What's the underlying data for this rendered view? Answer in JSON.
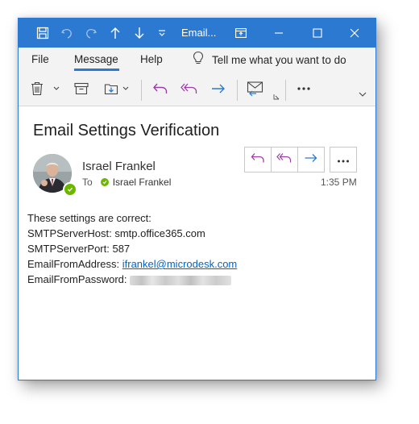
{
  "titlebar": {
    "title": "Email...",
    "icons": [
      "save-icon",
      "undo-icon",
      "redo-icon",
      "up-arrow-icon",
      "down-arrow-icon",
      "customize-icon",
      "ribbon-display-icon",
      "minimize-icon",
      "maximize-icon",
      "close-icon"
    ]
  },
  "menu": {
    "items": [
      "File",
      "Message",
      "Help"
    ],
    "active": "Message",
    "tell_me": "Tell me what you want to do"
  },
  "toolbar": {
    "icons": [
      "delete-icon",
      "archive-icon",
      "move-icon",
      "reply-icon",
      "reply-all-icon",
      "forward-icon",
      "meeting-reply-icon",
      "more-icon"
    ]
  },
  "email": {
    "subject": "Email Settings Verification",
    "sender": "Israel Frankel",
    "to_label": "To",
    "recipient": "Israel Frankel",
    "time": "1:35 PM",
    "body": {
      "line1": "These settings are correct:",
      "line2": "SMTPServerHost: smtp.office365.com",
      "line3": "SMTPServerPort: 587",
      "line4_label": "EmailFromAddress: ",
      "line4_link": "ifrankel@microdesk.com",
      "line5_label": "EmailFromPassword:"
    }
  },
  "colors": {
    "accent": "#2b79d0",
    "reply_purple": "#9b3fa6",
    "forward_blue": "#2b79d0",
    "presence_green": "#6bb700",
    "link": "#0563c1"
  }
}
